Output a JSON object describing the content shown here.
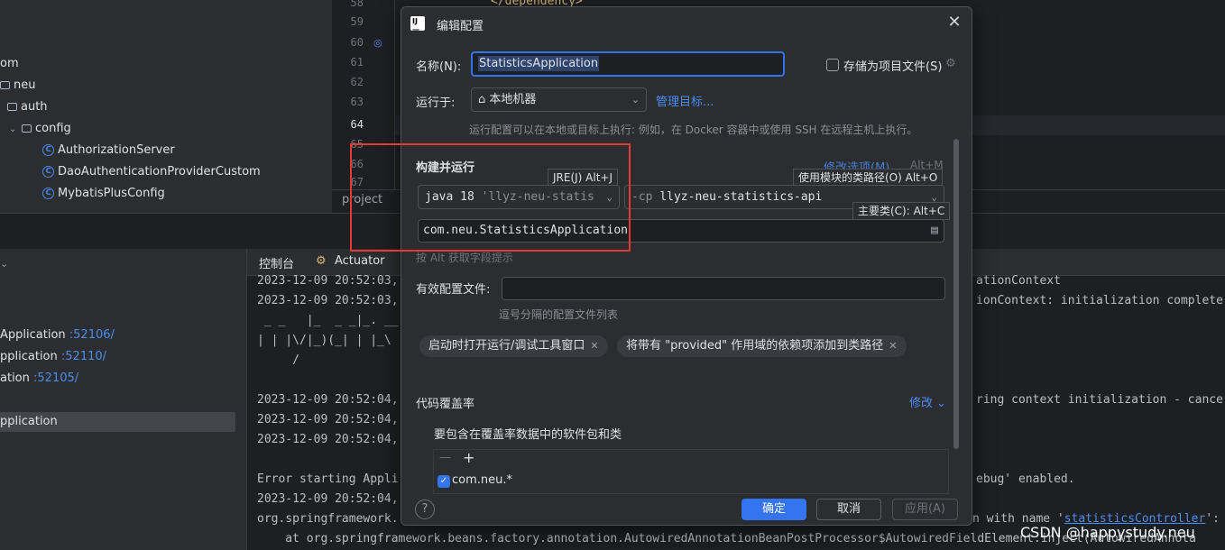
{
  "project_tree": {
    "items": [
      {
        "label": "om",
        "kind": "text"
      },
      {
        "label": "neu",
        "kind": "package"
      },
      {
        "label": "auth",
        "kind": "package"
      },
      {
        "label": "config",
        "kind": "package"
      },
      {
        "label": "AuthorizationServer",
        "kind": "class"
      },
      {
        "label": "DaoAuthenticationProviderCustom",
        "kind": "class"
      },
      {
        "label": "MybatisPlusConfig",
        "kind": "class"
      }
    ]
  },
  "editor": {
    "line_numbers": [
      "58",
      "59",
      "60",
      "61",
      "62",
      "63",
      "64",
      "65",
      "66",
      "67"
    ],
    "code_fragment": "</dependency>",
    "breadcrumb": "project"
  },
  "services": {
    "rows": [
      {
        "name": "Application",
        "port": ":52106/"
      },
      {
        "name": "pplication",
        "port": ":52110/"
      },
      {
        "name": "ation",
        "port": ":52105/"
      },
      {
        "name": "pplication",
        "port": ""
      }
    ]
  },
  "console": {
    "tabs": [
      {
        "label": "控制台"
      },
      {
        "label": "Actuator"
      }
    ],
    "left_lines": [
      "2023-12-09 20:52:03,",
      "2023-12-09 20:52:03,",
      " _ _   |_  _ _|_. __",
      "| | |\\/|_)(_| | |_\\",
      "     /",
      "2023-12-09 20:52:04,",
      "2023-12-09 20:52:04,",
      "2023-12-09 20:52:04,",
      "Error starting Appli",
      "2023-12-09 20:52:04,",
      "org.springframework.",
      "    at org.springframework.beans.factory.annotation.AutowiredAnnotationBeanPostProcessor$AutowiredFieldElement.inject(AutowiredAnnota"
    ],
    "right_lines": [
      "ationContext",
      "ionContext: initialization complete",
      "ring context initialization - cance",
      "ebug' enabled.",
      "n with name '"
    ],
    "right_link": "statisticsController",
    "right_tail": "':"
  },
  "dialog": {
    "title": "编辑配置",
    "name_label": "名称(N):",
    "name_value": "StatisticsApplication",
    "store_as_file": "存储为项目文件(S)",
    "run_on_label": "运行于:",
    "run_on_value": "本地机器",
    "manage_targets": "管理目标...",
    "run_on_hint": "运行配置可以在本地或目标上执行: 例如，在 Docker 容器中或使用 SSH 在远程主机上执行。",
    "build_run_title": "构建并运行",
    "modify_options": "修改选项(M)",
    "modify_shortcut": "Alt+M",
    "tooltip_jre": "JRE(J) Alt+J",
    "tooltip_classpath": "使用模块的类路径(O) Alt+O",
    "tooltip_mainclass": "主要类(C): Alt+C",
    "jre_version": "java 18",
    "jre_hint": "'llyz-neu-statis",
    "cp_prefix": "-cp",
    "cp_module": "llyz-neu-statistics-api",
    "main_class": "com.neu.StatisticsApplication",
    "alt_hint": "按 Alt 获取字段提示",
    "active_profiles_label": "有效配置文件:",
    "active_profiles_hint": "逗号分隔的配置文件列表",
    "chips": [
      "启动时打开运行/调试工具窗口",
      "将带有 \"provided\" 作用域的依赖项添加到类路径"
    ],
    "coverage_title": "代码覆盖率",
    "coverage_modify": "修改",
    "coverage_include_label": "要包含在覆盖率数据中的软件包和类",
    "coverage_remove": "—",
    "coverage_add": "+",
    "coverage_pattern": "com.neu.*",
    "ok": "确定",
    "cancel": "取消",
    "apply": "应用(A)",
    "help": "?"
  },
  "watermark": "CSDN @happystudy.neu"
}
